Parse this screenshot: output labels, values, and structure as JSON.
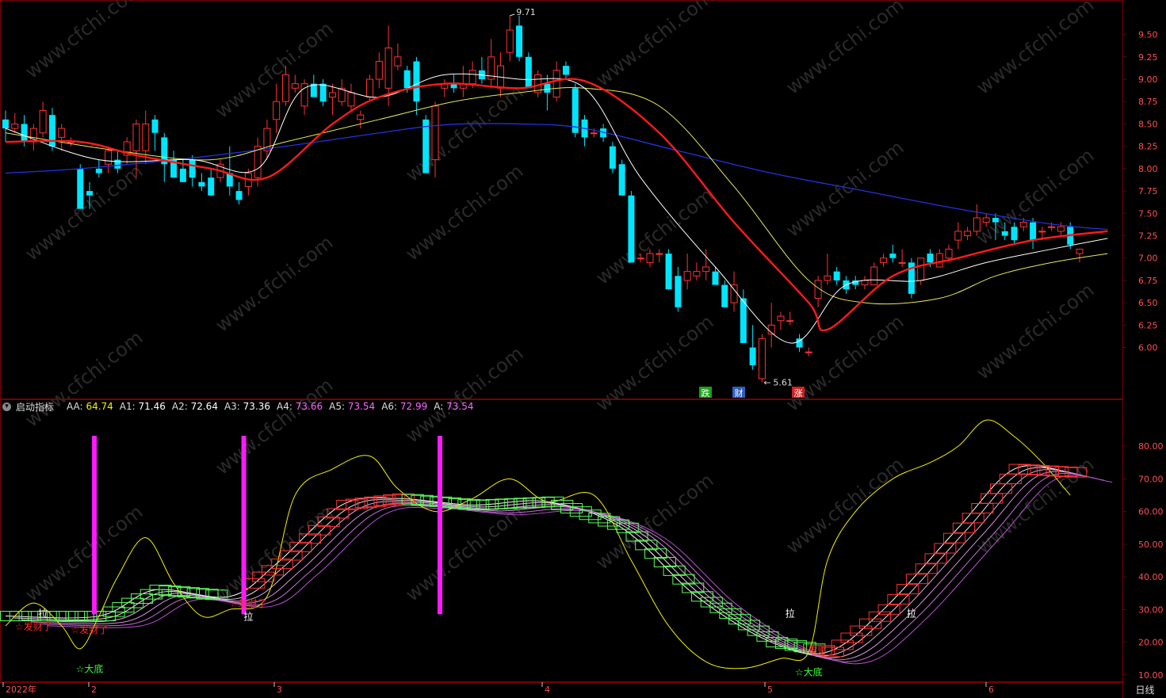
{
  "price_panel": {
    "y_axis_ticks": [
      "9.50",
      "9.25",
      "9.00",
      "8.75",
      "8.50",
      "8.25",
      "8.00",
      "7.75",
      "7.50",
      "7.25",
      "7.00",
      "6.75",
      "6.50",
      "6.25",
      "6.00"
    ],
    "high_label": "9.71",
    "low_label": "5.61",
    "signal_labels": [
      "跌",
      "财",
      "涨"
    ],
    "watermark": "www.cfchi.com"
  },
  "indicator_panel": {
    "name": "启动指标",
    "readouts": [
      {
        "label": "AA:",
        "value": "64.74",
        "color": "#f6f000"
      },
      {
        "label": "A1:",
        "value": "71.46",
        "color": "#ffffff"
      },
      {
        "label": "A2:",
        "value": "72.64",
        "color": "#ffffff"
      },
      {
        "label": "A3:",
        "value": "73.36",
        "color": "#ffffff"
      },
      {
        "label": "A4:",
        "value": "73.66",
        "color": "#ff66ff"
      },
      {
        "label": "A5:",
        "value": "73.54",
        "color": "#ff66ff"
      },
      {
        "label": "A6:",
        "value": "72.99",
        "color": "#ff66ff"
      },
      {
        "label": "A:",
        "value": "73.54",
        "color": "#ff66ff"
      }
    ],
    "y_axis_ticks": [
      "80.00",
      "70.00",
      "60.00",
      "50.00",
      "40.00",
      "30.00",
      "20.00",
      "10.00"
    ],
    "event_labels": {
      "pull": "拉",
      "fortune": "☆发财了",
      "bottom": "☆大底"
    }
  },
  "time_axis": {
    "labels": [
      "2022年",
      "2",
      "3",
      "4",
      "5",
      "6"
    ],
    "period": "日线"
  },
  "colors": {
    "up": "#ff3232",
    "down": "#00e5ff",
    "ma_red": "#ff1a1a",
    "ma_white": "#ffffff",
    "ma_yellow": "#e8e85a",
    "ma_blue": "#2233dd",
    "grid": "#7a0000"
  },
  "chart_data": [
    {
      "type": "candlestick",
      "title": "",
      "ylim": [
        5.5,
        9.78
      ],
      "candles": [
        [
          8.55,
          8.65,
          8.3,
          8.45
        ],
        [
          8.45,
          8.62,
          8.4,
          8.5
        ],
        [
          8.5,
          8.6,
          8.25,
          8.3
        ],
        [
          8.3,
          8.5,
          8.2,
          8.45
        ],
        [
          8.4,
          8.75,
          8.35,
          8.65
        ],
        [
          8.6,
          8.68,
          8.2,
          8.25
        ],
        [
          8.35,
          8.5,
          8.2,
          8.45
        ],
        [
          8.3,
          8.35,
          8.25,
          8.3
        ],
        [
          8.0,
          8.05,
          7.55,
          7.55
        ],
        [
          7.75,
          7.85,
          7.55,
          7.7
        ],
        [
          8.0,
          8.1,
          7.9,
          7.95
        ],
        [
          8.05,
          8.25,
          7.95,
          8.2
        ],
        [
          8.1,
          8.2,
          7.95,
          8.0
        ],
        [
          8.15,
          8.35,
          8.05,
          8.3
        ],
        [
          8.2,
          8.55,
          7.9,
          8.5
        ],
        [
          8.2,
          8.65,
          8.05,
          8.5
        ],
        [
          8.55,
          8.6,
          8.2,
          8.4
        ],
        [
          8.35,
          8.4,
          7.85,
          8.05
        ],
        [
          8.1,
          8.2,
          7.9,
          7.9
        ],
        [
          8.0,
          8.1,
          7.85,
          7.85
        ],
        [
          8.1,
          8.15,
          7.8,
          7.9
        ],
        [
          7.85,
          7.95,
          7.75,
          7.8
        ],
        [
          7.9,
          8.0,
          7.7,
          7.7
        ],
        [
          7.9,
          8.1,
          7.85,
          8.05
        ],
        [
          7.95,
          8.25,
          7.7,
          7.8
        ],
        [
          7.75,
          7.85,
          7.6,
          7.65
        ],
        [
          7.8,
          8.0,
          7.7,
          7.95
        ],
        [
          7.9,
          8.35,
          7.8,
          8.25
        ],
        [
          8.2,
          8.55,
          8.1,
          8.45
        ],
        [
          8.55,
          8.95,
          8.4,
          8.75
        ],
        [
          8.75,
          9.15,
          8.7,
          9.05
        ],
        [
          8.9,
          9.05,
          8.85,
          8.95
        ],
        [
          8.7,
          9.0,
          8.6,
          8.95
        ],
        [
          8.95,
          9.05,
          8.8,
          8.8
        ],
        [
          8.95,
          9.0,
          8.7,
          8.75
        ],
        [
          8.8,
          8.95,
          8.6,
          8.85
        ],
        [
          8.75,
          9.0,
          8.7,
          8.9
        ],
        [
          8.7,
          8.95,
          8.65,
          8.85
        ],
        [
          8.55,
          8.65,
          8.45,
          8.6
        ],
        [
          8.8,
          9.05,
          8.75,
          9.0
        ],
        [
          9.0,
          9.3,
          8.9,
          9.2
        ],
        [
          8.9,
          9.6,
          8.7,
          9.35
        ],
        [
          9.15,
          9.4,
          9.1,
          9.25
        ],
        [
          9.1,
          9.15,
          8.85,
          8.9
        ],
        [
          9.2,
          9.25,
          8.6,
          8.75
        ],
        [
          8.55,
          8.6,
          7.95,
          7.95
        ],
        [
          8.1,
          8.75,
          7.9,
          8.7
        ],
        [
          8.9,
          9.0,
          8.8,
          8.95
        ],
        [
          8.95,
          9.05,
          8.85,
          8.9
        ],
        [
          8.9,
          9.15,
          8.8,
          8.95
        ],
        [
          8.95,
          9.2,
          8.9,
          9.1
        ],
        [
          9.1,
          9.25,
          8.95,
          9.0
        ],
        [
          9.0,
          9.45,
          8.9,
          9.25
        ],
        [
          8.9,
          9.3,
          8.8,
          9.15
        ],
        [
          9.3,
          9.71,
          9.2,
          9.55
        ],
        [
          9.6,
          9.71,
          9.2,
          9.25
        ],
        [
          9.25,
          9.3,
          8.9,
          8.9
        ],
        [
          8.85,
          9.1,
          8.8,
          9.05
        ],
        [
          8.95,
          9.05,
          8.65,
          8.85
        ],
        [
          8.8,
          9.2,
          8.75,
          9.1
        ],
        [
          9.15,
          9.2,
          9.0,
          9.05
        ],
        [
          8.9,
          8.95,
          8.35,
          8.4
        ],
        [
          8.55,
          8.6,
          8.25,
          8.35
        ],
        [
          8.4,
          8.45,
          8.35,
          8.4
        ],
        [
          8.45,
          8.5,
          8.3,
          8.35
        ],
        [
          8.25,
          8.3,
          7.95,
          8.0
        ],
        [
          8.05,
          8.1,
          7.7,
          7.7
        ],
        [
          7.7,
          7.75,
          6.95,
          6.95
        ],
        [
          7.0,
          7.05,
          6.95,
          7.0
        ],
        [
          6.95,
          7.1,
          6.9,
          7.05
        ],
        [
          7.05,
          7.1,
          6.95,
          7.05
        ],
        [
          7.05,
          7.1,
          6.65,
          6.65
        ],
        [
          6.8,
          6.9,
          6.4,
          6.45
        ],
        [
          6.75,
          7.05,
          6.65,
          6.85
        ],
        [
          6.8,
          6.95,
          6.75,
          6.85
        ],
        [
          6.85,
          7.1,
          6.75,
          6.9
        ],
        [
          6.85,
          6.9,
          6.7,
          6.7
        ],
        [
          6.7,
          6.75,
          6.45,
          6.45
        ],
        [
          6.5,
          6.85,
          6.4,
          6.7
        ],
        [
          6.55,
          6.65,
          6.05,
          6.05
        ],
        [
          6.0,
          6.25,
          5.75,
          5.8
        ],
        [
          5.65,
          6.15,
          5.61,
          6.1
        ],
        [
          6.15,
          6.5,
          6.0,
          6.25
        ],
        [
          6.3,
          6.4,
          6.2,
          6.35
        ],
        [
          6.3,
          6.4,
          6.25,
          6.3
        ],
        [
          6.1,
          6.15,
          5.95,
          6.0
        ],
        [
          5.95,
          6.0,
          5.9,
          5.95
        ],
        [
          6.55,
          6.8,
          6.45,
          6.75
        ],
        [
          6.75,
          7.05,
          6.7,
          6.8
        ],
        [
          6.85,
          6.9,
          6.7,
          6.75
        ],
        [
          6.75,
          6.8,
          6.6,
          6.65
        ],
        [
          6.75,
          6.8,
          6.65,
          6.7
        ],
        [
          6.7,
          6.8,
          6.65,
          6.75
        ],
        [
          6.7,
          6.95,
          6.7,
          6.9
        ],
        [
          6.95,
          7.05,
          6.9,
          7.0
        ],
        [
          7.05,
          7.15,
          6.95,
          7.0
        ],
        [
          6.95,
          7.1,
          6.9,
          6.95
        ],
        [
          6.95,
          7.0,
          6.55,
          6.6
        ],
        [
          6.75,
          7.0,
          6.7,
          7.0
        ],
        [
          7.05,
          7.1,
          6.9,
          6.95
        ],
        [
          6.9,
          7.1,
          6.9,
          7.05
        ],
        [
          7.0,
          7.15,
          6.95,
          7.1
        ],
        [
          7.2,
          7.4,
          7.1,
          7.3
        ],
        [
          7.25,
          7.35,
          7.2,
          7.3
        ],
        [
          7.3,
          7.6,
          7.25,
          7.45
        ],
        [
          7.4,
          7.5,
          7.35,
          7.45
        ],
        [
          7.45,
          7.5,
          7.2,
          7.4
        ],
        [
          7.3,
          7.4,
          7.2,
          7.25
        ],
        [
          7.35,
          7.4,
          7.15,
          7.2
        ],
        [
          7.35,
          7.45,
          7.3,
          7.4
        ],
        [
          7.4,
          7.45,
          7.1,
          7.2
        ],
        [
          7.3,
          7.35,
          7.2,
          7.3
        ],
        [
          7.35,
          7.4,
          7.3,
          7.35
        ],
        [
          7.3,
          7.4,
          7.25,
          7.35
        ],
        [
          7.35,
          7.4,
          7.1,
          7.15
        ],
        [
          7.05,
          7.1,
          6.95,
          7.1
        ]
      ],
      "ma": {
        "white": [
          [
            0,
            8.45
          ],
          [
            10,
            8.1
          ],
          [
            20,
            8.1
          ],
          [
            27,
            8.0
          ],
          [
            32,
            8.9
          ],
          [
            40,
            8.8
          ],
          [
            47,
            9.05
          ],
          [
            55,
            9.0
          ],
          [
            62,
            8.9
          ],
          [
            68,
            7.9
          ],
          [
            76,
            6.9
          ],
          [
            84,
            6.05
          ],
          [
            90,
            6.7
          ],
          [
            98,
            6.75
          ],
          [
            105,
            6.95
          ],
          [
            112,
            7.1
          ],
          [
            118,
            7.22
          ]
        ],
        "red": [
          [
            0,
            8.3
          ],
          [
            8,
            8.3
          ],
          [
            14,
            8.15
          ],
          [
            22,
            8.0
          ],
          [
            28,
            7.9
          ],
          [
            35,
            8.5
          ],
          [
            40,
            8.8
          ],
          [
            47,
            8.95
          ],
          [
            55,
            8.9
          ],
          [
            62,
            8.98
          ],
          [
            70,
            8.4
          ],
          [
            78,
            7.4
          ],
          [
            86,
            6.5
          ],
          [
            88,
            6.2
          ],
          [
            95,
            6.8
          ],
          [
            102,
            7.0
          ],
          [
            110,
            7.2
          ],
          [
            118,
            7.3
          ]
        ],
        "yellow": [
          [
            0,
            8.4
          ],
          [
            12,
            8.2
          ],
          [
            22,
            8.1
          ],
          [
            30,
            8.3
          ],
          [
            40,
            8.55
          ],
          [
            48,
            8.75
          ],
          [
            55,
            8.85
          ],
          [
            62,
            8.9
          ],
          [
            70,
            8.7
          ],
          [
            78,
            7.8
          ],
          [
            86,
            6.75
          ],
          [
            92,
            6.5
          ],
          [
            100,
            6.55
          ],
          [
            106,
            6.8
          ],
          [
            112,
            6.95
          ],
          [
            118,
            7.05
          ]
        ],
        "blue": [
          [
            0,
            7.95
          ],
          [
            8,
            8.0
          ],
          [
            20,
            8.12
          ],
          [
            30,
            8.25
          ],
          [
            40,
            8.4
          ],
          [
            47,
            8.49
          ],
          [
            55,
            8.5
          ],
          [
            62,
            8.45
          ],
          [
            72,
            8.2
          ],
          [
            82,
            7.95
          ],
          [
            92,
            7.75
          ],
          [
            102,
            7.55
          ],
          [
            112,
            7.38
          ],
          [
            118,
            7.32
          ]
        ]
      },
      "high": {
        "index": 54,
        "value": 9.71
      },
      "low": {
        "index": 81,
        "value": 5.61
      }
    },
    {
      "type": "line",
      "title": "启动指标",
      "ylim": [
        8,
        90
      ],
      "series": [
        {
          "name": "AA",
          "values": [
            [
              0,
              25
            ],
            [
              3,
              32
            ],
            [
              6,
              25
            ],
            [
              8,
              18
            ],
            [
              10,
              28
            ],
            [
              12,
              40
            ],
            [
              15,
              52
            ],
            [
              18,
              38
            ],
            [
              21,
              28
            ],
            [
              24,
              30
            ],
            [
              28,
              34
            ],
            [
              31,
              65
            ],
            [
              35,
              73
            ],
            [
              39,
              77
            ],
            [
              42,
              67
            ],
            [
              46,
              60
            ],
            [
              50,
              64
            ],
            [
              54,
              70
            ],
            [
              58,
              63
            ],
            [
              63,
              65
            ],
            [
              67,
              45
            ],
            [
              71,
              25
            ],
            [
              75,
              14
            ],
            [
              79,
              12
            ],
            [
              83,
              15
            ],
            [
              86,
              17
            ],
            [
              88,
              45
            ],
            [
              91,
              60
            ],
            [
              95,
              70
            ],
            [
              99,
              75
            ],
            [
              102,
              80
            ],
            [
              105,
              88
            ],
            [
              108,
              83
            ],
            [
              111,
              75
            ],
            [
              114,
              65
            ]
          ]
        },
        {
          "name": "A1",
          "values": [
            [
              0,
              28
            ],
            [
              10,
              28
            ],
            [
              16,
              36
            ],
            [
              24,
              34
            ],
            [
              29,
              44
            ],
            [
              36,
              62
            ],
            [
              42,
              64
            ],
            [
              50,
              62
            ],
            [
              58,
              63
            ],
            [
              66,
              55
            ],
            [
              74,
              34
            ],
            [
              82,
              20
            ],
            [
              88,
              17
            ],
            [
              94,
              30
            ],
            [
              102,
              55
            ],
            [
              108,
              73
            ],
            [
              114,
              72
            ]
          ]
        }
      ],
      "markers": {
        "pulls": [
          [
            4,
            29
          ],
          [
            26,
            28
          ],
          [
            84,
            29
          ],
          [
            97,
            29
          ]
        ],
        "fortune": [
          [
            3,
            25
          ],
          [
            9,
            24
          ],
          [
            26,
            32
          ],
          [
            87,
            18
          ]
        ],
        "bottom": [
          [
            9,
            12
          ],
          [
            86,
            11
          ]
        ],
        "magenta_bars": [
          9,
          25,
          46
        ]
      }
    }
  ]
}
